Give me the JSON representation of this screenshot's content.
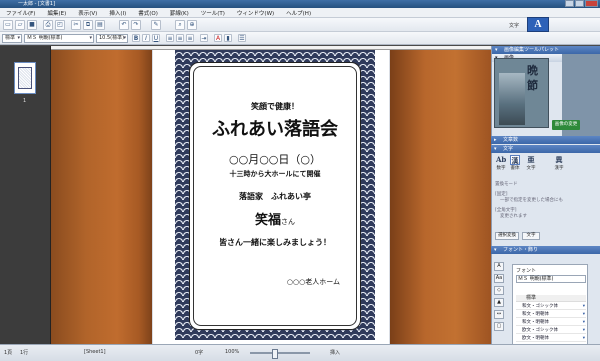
{
  "window": {
    "title": "一太郎 - [文書1]"
  },
  "menubar": {
    "items": [
      "ファイル(F)",
      "編集(E)",
      "表示(V)",
      "挿入(I)",
      "書式(O)",
      "罫線(K)",
      "ツール(T)",
      "ウィンドウ(W)",
      "ヘルプ(H)"
    ]
  },
  "toolbar": {
    "style_value": "標準",
    "font_value": "ＭＳ 明朝(標準)",
    "size_value": "10.5(標準)",
    "bold": "B",
    "italic": "I",
    "underline": "U",
    "mode_label": "文字",
    "mode_button": "A",
    "icons": [
      "new-doc-icon",
      "open-folder-icon",
      "save-icon",
      "print-icon",
      "print-preview-icon",
      "undo-icon",
      "redo-icon",
      "cut-icon",
      "copy-icon",
      "paste-icon",
      "search-icon",
      "zoom-icon"
    ]
  },
  "thumbnails": {
    "page_number": "1"
  },
  "flyer": {
    "tagline": "笑顔で健康！",
    "title": "ふれあい落語会",
    "date": "○○月○○日（○）",
    "time_place": "十三時から大ホールにて開催",
    "performer_line": "落語家　ふれあい亭",
    "performer_name": "笑福",
    "performer_suffix": "さん",
    "invite": "皆さん一緒に楽しみましょう！",
    "organizer": "○○○老人ホーム"
  },
  "right_panel": {
    "header_title": "画像編集ツールパレット",
    "section_img": "画像",
    "preview_title": "晩節",
    "apply_button": "画像の変更",
    "section_doc": "文章数",
    "section_char": "文字",
    "modes": [
      {
        "icon": "Ab",
        "label": "数字"
      },
      {
        "icon": "漢",
        "label": "書体"
      },
      {
        "icon": "亜",
        "label": "文字"
      },
      {
        "icon": "異",
        "label": "漢字"
      }
    ],
    "option_label": "置換モード",
    "radio1": "[固定]",
    "radio2": "[全角文字]",
    "note1": "一部で指定を変更した場合にも",
    "note2": "変更されます",
    "btn1": "選択変換",
    "btn2": "文字",
    "section_font": "フォント・飾り",
    "font_label": "フォント",
    "font_value": "ＭＳ 明朝(標準)",
    "list_header": "標準",
    "font_list": [
      "和文・ゴシック体",
      "和文・明朝体",
      "和文・明朝体",
      "欧文・ゴシック体",
      "欧文・明朝体"
    ]
  },
  "statusbar": {
    "page": "1頁",
    "line": "1行",
    "col": "0字",
    "sheet": "[Sheet1]",
    "zoom": "100%",
    "mode": "挿入"
  }
}
